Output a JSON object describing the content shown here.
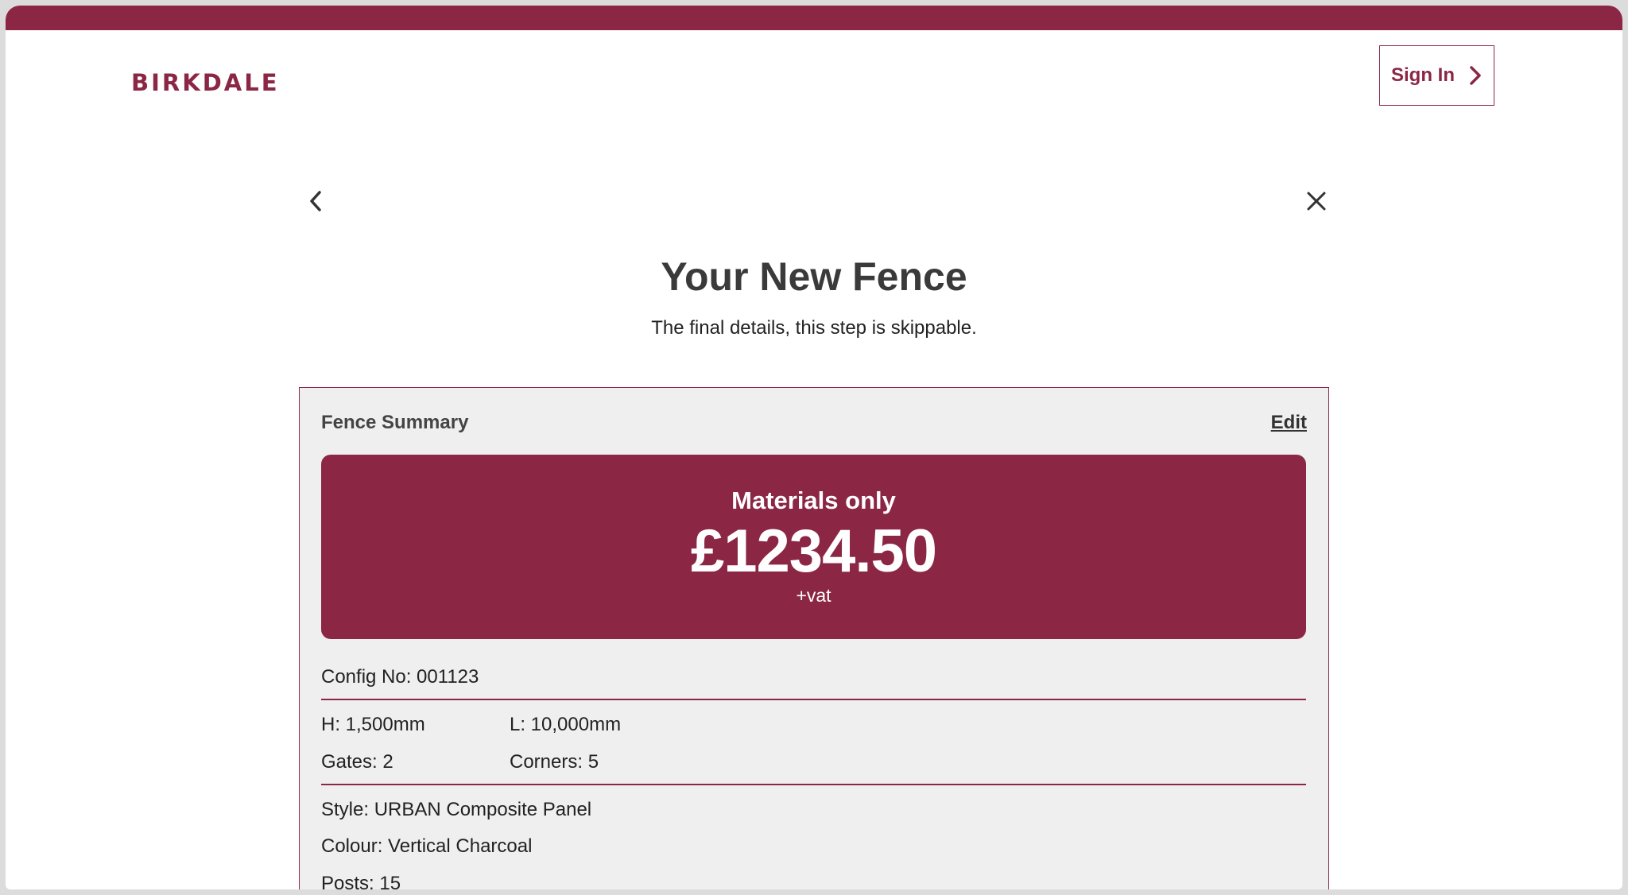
{
  "header": {
    "logo_text": "BIRKDALE",
    "sign_in_label": "Sign In"
  },
  "page": {
    "title": "Your New Fence",
    "subtitle": "The final details, this step is skippable."
  },
  "summary": {
    "title": "Fence Summary",
    "edit_label": "Edit",
    "price_label": "Materials only",
    "price_value": "£1234.50",
    "price_suffix": "+vat",
    "config_no": "Config No: 001123",
    "height": "H: 1,500mm",
    "length": "L: 10,000mm",
    "gates": "Gates: 2",
    "corners": "Corners: 5",
    "style": "Style: URBAN Composite Panel",
    "colour": "Colour: Vertical Charcoal",
    "posts": "Posts: 15"
  },
  "icons": {
    "back": "chevron-left-icon",
    "close": "close-icon",
    "sign_in_arrow": "chevron-right-icon"
  },
  "colors": {
    "brand": "#8b2744",
    "card_background": "#efefef",
    "text": "#222222"
  }
}
